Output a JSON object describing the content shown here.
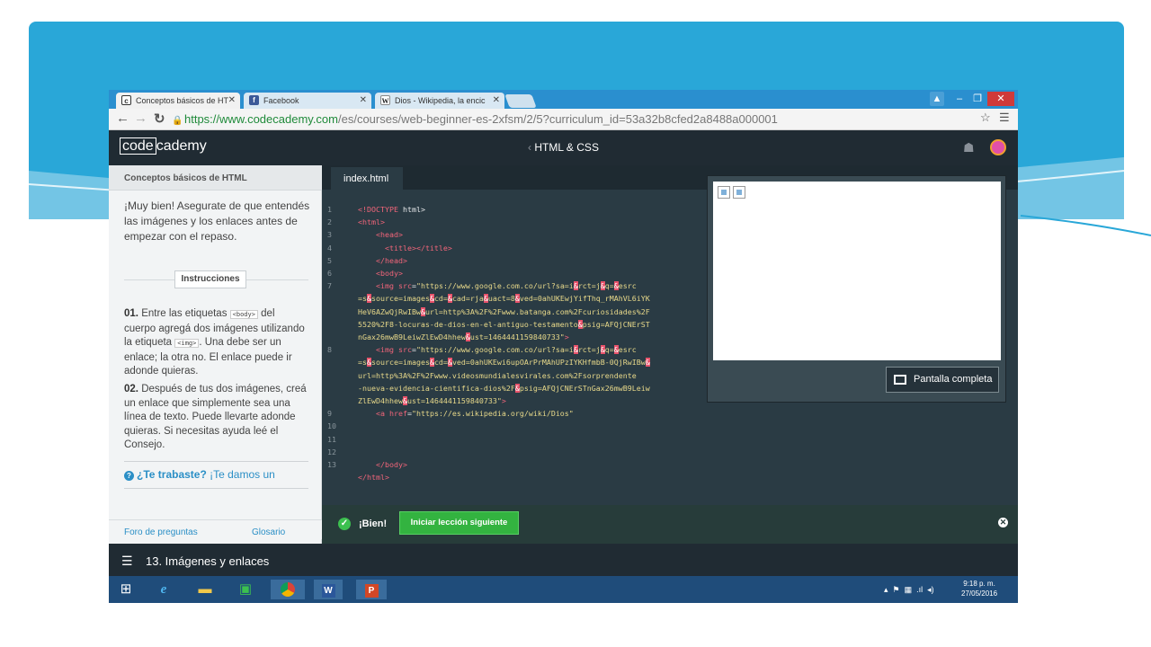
{
  "browser": {
    "tabs": [
      {
        "label": "Conceptos básicos de HT",
        "icon": "codecademy-favicon"
      },
      {
        "label": "Facebook",
        "icon": "facebook-favicon"
      },
      {
        "label": "Dios - Wikipedia, la encic",
        "icon": "wikipedia-favicon"
      }
    ],
    "url_secure": "https://www.codecademy.com",
    "url_rest": "/es/courses/web-beginner-es-2xfsm/2/5?curriculum_id=53a32b8cfed2a8488a000001"
  },
  "header": {
    "logo_boxed": "code",
    "logo_rest": "cademy",
    "course_title": "HTML & CSS"
  },
  "lesson": {
    "title": "Conceptos básicos de HTML",
    "intro": "¡Muy bien! Asegurate de que entendés las imágenes y los enlaces antes de empezar con el repaso.",
    "instructions_label": "Instrucciones",
    "step1_num": "01.",
    "step1_a": " Entre las etiquetas ",
    "step1_tag1": "<body>",
    "step1_b": " del cuerpo agregá dos imágenes utilizando la etiqueta ",
    "step1_tag2": "<img>",
    "step1_c": ". Una debe ser un enlace; la otra no. El enlace puede ir adonde quieras.",
    "step2_num": "02.",
    "step2_text": " Después de tus dos imágenes, creá un enlace que simplemente sea una línea de texto. Puede llevarte adonde quieras. Si necesitas ayuda leé el Consejo.",
    "help_strong": "¿Te trabaste?",
    "help_rest": " ¡Te damos un",
    "forum_link": "Foro de preguntas",
    "glossary_link": "Glosario"
  },
  "editor": {
    "file_tab": "index.html",
    "line_numbers": [
      "1",
      "2",
      "3",
      "4",
      "5",
      "6",
      "7",
      "",
      "",
      "",
      "",
      "8",
      "",
      "",
      "",
      "",
      "9",
      "10",
      "11",
      "12",
      "13"
    ]
  },
  "preview": {
    "fullscreen_label": "Pantalla completa"
  },
  "result": {
    "status": "¡Bien!",
    "next_button": "Iniciar lección siguiente"
  },
  "unit": {
    "title": "13. Imágenes y enlaces"
  },
  "taskbar": {
    "time": "9:18 p. m.",
    "date": "27/05/2016"
  },
  "colors": {
    "banner": "#29a7d8",
    "header": "#202b33",
    "editor_bg": "#2a3b44",
    "success": "#33b340",
    "link": "#2b8fc6"
  }
}
